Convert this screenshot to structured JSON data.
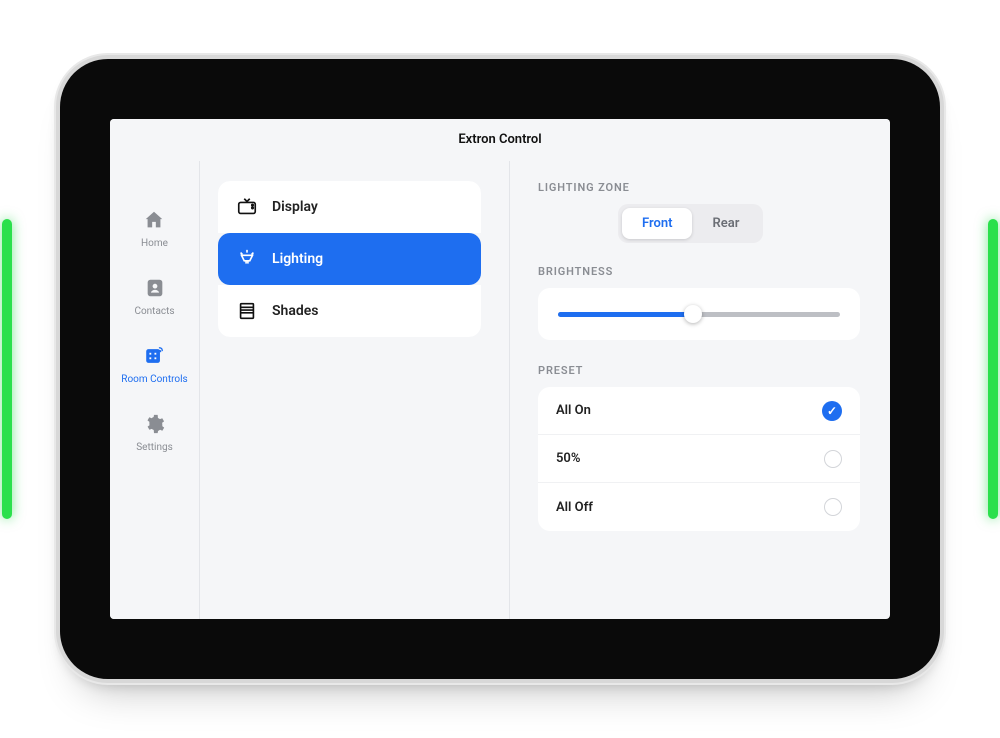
{
  "title": "Extron Control",
  "sidenav": [
    {
      "id": "home",
      "label": "Home",
      "icon": "home-icon",
      "active": false
    },
    {
      "id": "contacts",
      "label": "Contacts",
      "icon": "contacts-icon",
      "active": false
    },
    {
      "id": "room-controls",
      "label": "Room Controls",
      "icon": "room-controls-icon",
      "active": true
    },
    {
      "id": "settings",
      "label": "Settings",
      "icon": "settings-icon",
      "active": false
    }
  ],
  "categories": [
    {
      "id": "display",
      "label": "Display",
      "icon": "tv-icon",
      "active": false
    },
    {
      "id": "lighting",
      "label": "Lighting",
      "icon": "light-icon",
      "active": true
    },
    {
      "id": "shades",
      "label": "Shades",
      "icon": "shades-icon",
      "active": false
    }
  ],
  "lighting": {
    "zone_label": "LIGHTING ZONE",
    "zones": [
      {
        "label": "Front",
        "active": true
      },
      {
        "label": "Rear",
        "active": false
      }
    ],
    "brightness_label": "BRIGHTNESS",
    "brightness_percent": 48,
    "preset_label": "PRESET",
    "presets": [
      {
        "label": "All On",
        "selected": true
      },
      {
        "label": "50%",
        "selected": false
      },
      {
        "label": "All Off",
        "selected": false
      }
    ]
  },
  "device": {
    "led_color": "#2be04c"
  }
}
